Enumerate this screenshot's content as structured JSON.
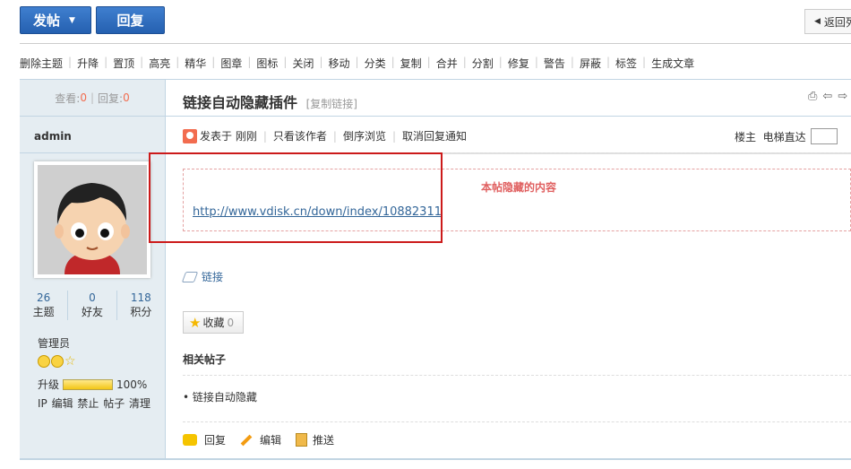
{
  "topbar": {
    "post_label": "发帖",
    "reply_label": "回复",
    "back_label": "返回列"
  },
  "modbar": {
    "items": [
      "删除主题",
      "升降",
      "置顶",
      "高亮",
      "精华",
      "图章",
      "图标",
      "关闭",
      "移动",
      "分类",
      "复制",
      "合并",
      "分割",
      "修复",
      "警告",
      "屏蔽",
      "标签",
      "生成文章"
    ]
  },
  "sidebar": {
    "views_label": "查看:",
    "views_value": "0",
    "replies_label": "回复:",
    "replies_value": "0",
    "author": "admin",
    "stats": [
      {
        "num": "26",
        "label": "主题"
      },
      {
        "num": "0",
        "label": "好友"
      },
      {
        "num": "118",
        "label": "积分"
      }
    ],
    "rank": "管理员",
    "upgrade_label": "升级",
    "upgrade_percent": "100%",
    "upgrade_progress": 1.0,
    "user_actions": "IP 编辑 禁止 帖子 清理"
  },
  "post": {
    "title": "链接自动隐藏插件",
    "copy_link": "[复制链接]",
    "posted_label": "发表于",
    "posted_time": "刚刚",
    "only_author": "只看该作者",
    "reverse": "倒序浏览",
    "cancel_notify": "取消回复通知",
    "floor_label": "楼主",
    "jump_label": "电梯直达",
    "hidden_title": "本帖隐藏的内容",
    "hidden_url": "http://www.vdisk.cn/down/index/10882311",
    "tag": "链接",
    "fav_label": "收藏",
    "fav_count": "0",
    "related_title": "相关帖子",
    "related_items": [
      "• 链接自动隐藏"
    ],
    "action_reply": "回复",
    "action_edit": "编辑",
    "action_push": "推送"
  }
}
